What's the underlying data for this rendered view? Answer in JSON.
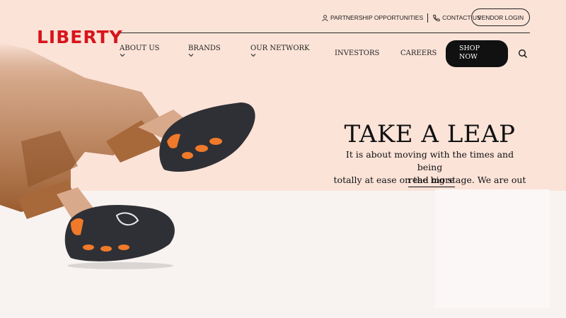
{
  "brand": {
    "logo_text": "LIBERTY",
    "logo_color": "#d7151b"
  },
  "topbar": {
    "partnership_label": "PARTNERSHIP OPPORTUNITIES",
    "contact_label": "CONTACT US",
    "vendor_login_label": "VENDOR LOGIN",
    "partnership_icon": "user-icon",
    "contact_icon": "phone-icon"
  },
  "nav": {
    "items": [
      {
        "label": "ABOUT US",
        "has_dropdown": true
      },
      {
        "label": "BRANDS",
        "has_dropdown": true
      },
      {
        "label": "OUR NETWORK",
        "has_dropdown": true
      },
      {
        "label": "INVESTORS",
        "has_dropdown": false
      },
      {
        "label": "CAREERS",
        "has_dropdown": false
      }
    ],
    "shop_now_label": "SHOP NOW",
    "search_icon": "search-icon"
  },
  "hero": {
    "headline": "TAKE A LEAP",
    "tagline_line1": "It is about moving with the times and being",
    "tagline_line2": "totally at ease on the big stage. We are out",
    "read_more_label": "read more",
    "image_description_icon": "clog-sandals-illustration"
  },
  "colors": {
    "accent": "#d7151b",
    "hero_bg": "#fbe3d8",
    "button_bg": "#111111"
  }
}
